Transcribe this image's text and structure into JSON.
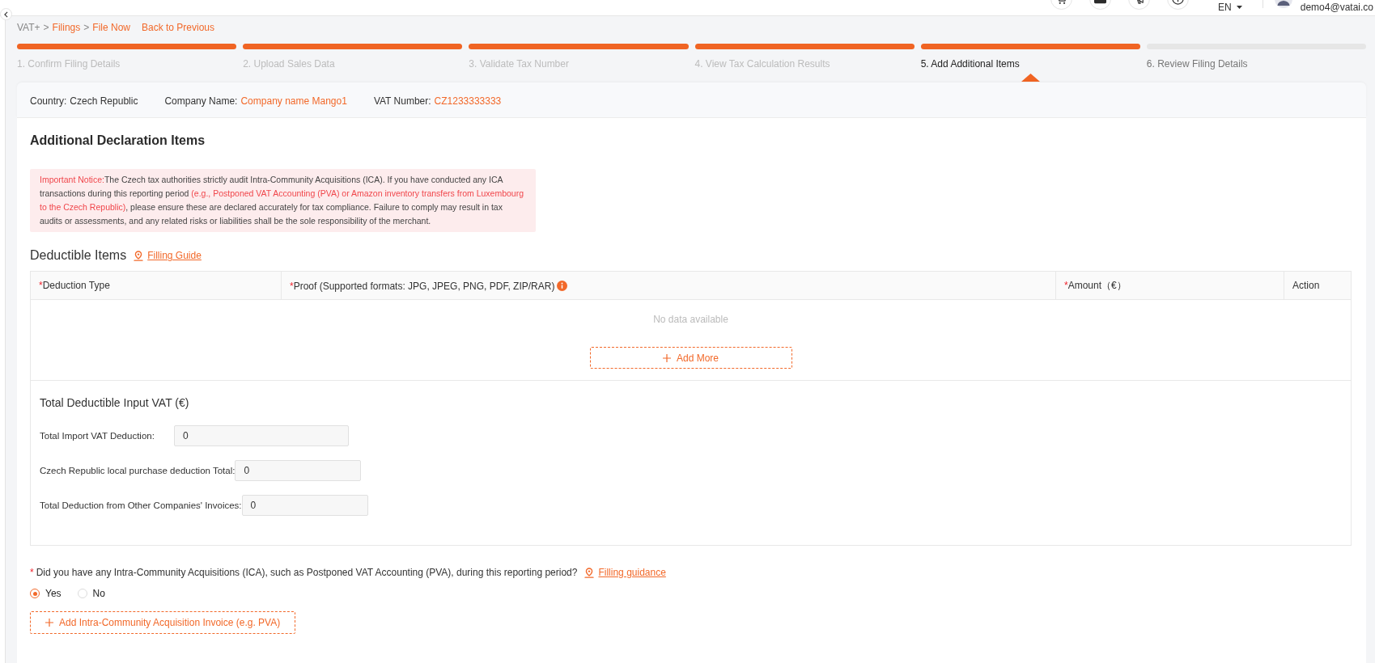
{
  "header": {
    "icon_buttons": [
      {
        "kind": "cart"
      },
      {
        "kind": "mail"
      },
      {
        "kind": "megaphone"
      },
      {
        "kind": "info"
      }
    ],
    "language": "EN",
    "user_email": "demo4@vatai.co"
  },
  "breadcrumb": [
    {
      "label": "VAT+",
      "kind": "text"
    },
    {
      "label": ">",
      "kind": "separator"
    },
    {
      "label": "Filings",
      "kind": "link"
    },
    {
      "label": ">",
      "kind": "separator"
    },
    {
      "label": "File Now",
      "kind": "link"
    }
  ],
  "back_link": "Back to Previous",
  "steps": [
    {
      "label": "1. Confirm Filing Details",
      "reached": true,
      "selected": false
    },
    {
      "label": "2. Upload Sales Data",
      "reached": true,
      "selected": false
    },
    {
      "label": "3. Validate Tax Number",
      "reached": true,
      "selected": false
    },
    {
      "label": "4. View Tax Calculation Results",
      "reached": true,
      "selected": false
    },
    {
      "label": "5. Add Additional Items",
      "reached": true,
      "selected": true
    },
    {
      "label": "6. Review Filing Details",
      "reached": false,
      "selected": false
    }
  ],
  "filing_info": [
    {
      "label": "Country:",
      "value": "Czech Republic",
      "highlight": false
    },
    {
      "label": "Company Name:",
      "value": "Company name Mango1",
      "highlight": true
    },
    {
      "label": "VAT Number:",
      "value": "CZ1233333333",
      "highlight": true
    }
  ],
  "section_title": "Additional Declaration Items",
  "notice": {
    "parts": [
      {
        "text": "Important Notice:",
        "highlight": true
      },
      {
        "text": "The Czech tax authorities strictly audit Intra-Community Acquisitions (ICA). If you have conducted any ICA transactions during this reporting period ",
        "highlight": false
      },
      {
        "text": "(e.g., Postponed VAT Accounting (PVA) or Amazon inventory transfers from Luxembourg to the Czech Republic)",
        "highlight": true
      },
      {
        "text": ", please ensure these are declared accurately for tax compliance. Failure to comply may result in tax audits or assessments, and any related risks or liabilities shall be the sole responsibility of the merchant.",
        "highlight": false
      }
    ]
  },
  "deductible_items": {
    "title": "Deductible Items",
    "guide_link": "Filling Guide",
    "table": {
      "columns": [
        {
          "label": "Deduction Type",
          "required_mark": "*",
          "info": false
        },
        {
          "label": "Proof (Supported formats: JPG, JPEG, PNG, PDF, ZIP/RAR)",
          "required_mark": "*",
          "info": true
        },
        {
          "label": "Amount（€）",
          "required_mark": "*",
          "info": false
        },
        {
          "label": "Action",
          "info": false
        }
      ],
      "empty_text": "No data available",
      "add_button": "Add More"
    },
    "totals": {
      "title": "Total Deductible Input VAT (€)",
      "fields": [
        {
          "label": "Total Import VAT Deduction:",
          "value": "0"
        },
        {
          "label": "Czech Republic local purchase deduction Total:",
          "value": "0"
        },
        {
          "label": "Total Deduction from Other Companies' Invoices:",
          "value": "0"
        }
      ]
    }
  },
  "ica_question": {
    "required_mark": "*",
    "text": "Did you have any Intra-Community Acquisitions (ICA), such as Postponed VAT Accounting (PVA), during this reporting period?",
    "guide_link": "Filling guidance",
    "options": [
      {
        "label": "Yes",
        "selected": true
      },
      {
        "label": "No",
        "selected": false
      }
    ],
    "add_button": "Add Intra-Community Acquisition Invoice (e.g. PVA)"
  }
}
